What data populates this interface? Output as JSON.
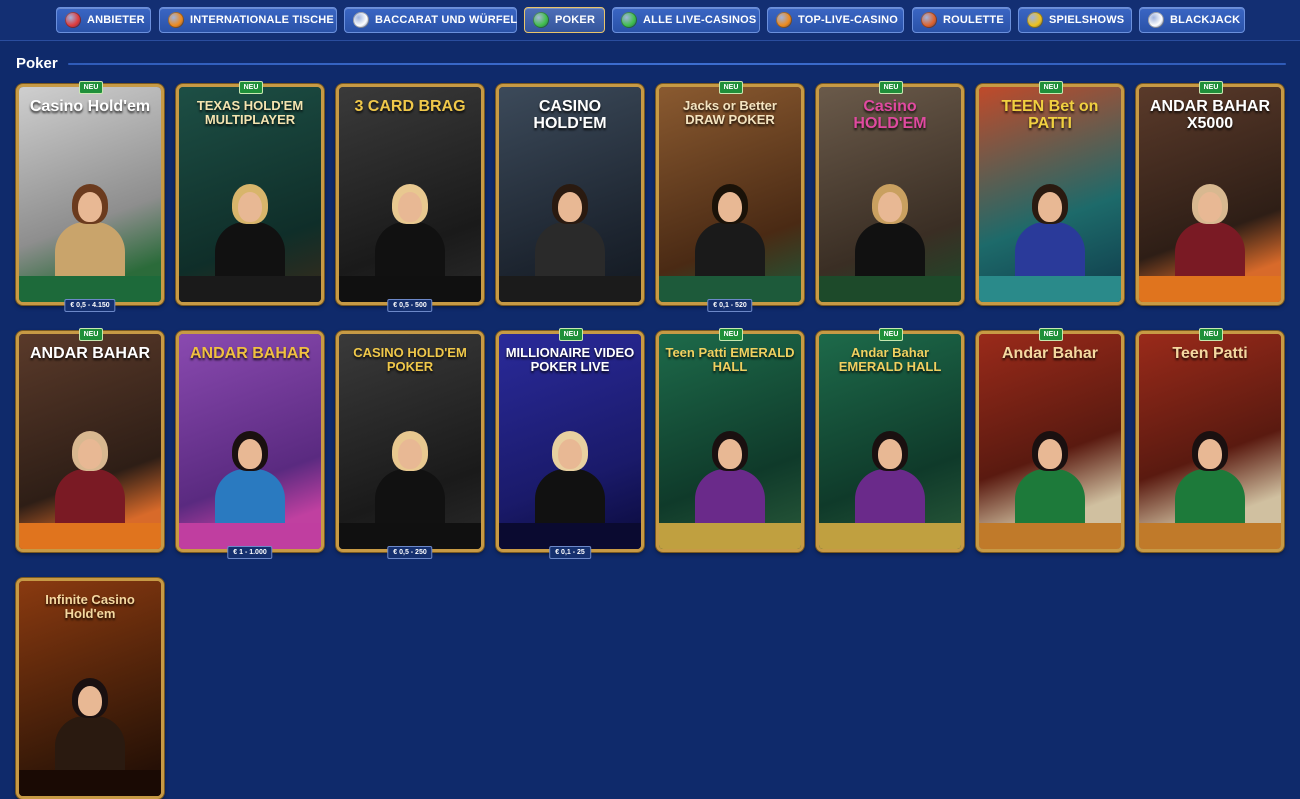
{
  "categories": [
    {
      "label": "ANBIETER",
      "icon": "provider-icon",
      "color": "#e03a3a",
      "active": false
    },
    {
      "label": "INTERNATIONALE TISCHE",
      "icon": "compass-icon",
      "color": "#f08a1a",
      "active": false
    },
    {
      "label": "BACCARAT UND WÜRFEL",
      "icon": "dice-cards-icon",
      "color": "#ffffff",
      "active": false
    },
    {
      "label": "POKER",
      "icon": "poker-chips-icon",
      "color": "#3fbf4a",
      "active": true
    },
    {
      "label": "ALLE LIVE-CASINOS",
      "icon": "chips-icon",
      "color": "#3fbf4a",
      "active": false
    },
    {
      "label": "TOP-LIVE-CASINO",
      "icon": "star-icon",
      "color": "#f08a1a",
      "active": false
    },
    {
      "label": "ROULETTE",
      "icon": "roulette-icon",
      "color": "#e0622a",
      "active": false
    },
    {
      "label": "SPIELSHOWS",
      "icon": "microphone-icon",
      "color": "#f0c21a",
      "active": false
    },
    {
      "label": "BLACKJACK",
      "icon": "cards-icon",
      "color": "#ffffff",
      "active": false
    }
  ],
  "section": {
    "title": "Poker"
  },
  "games": [
    {
      "name": "Casino Hold'em",
      "badge": "NEU",
      "limit": "€ 0,5 - 4.150",
      "theme": "marble"
    },
    {
      "name": "TEXAS HOLD'EM MULTIPLAYER",
      "badge": "NEU",
      "limit": "",
      "theme": "green"
    },
    {
      "name": "3 CARD BRAG",
      "badge": "",
      "limit": "€ 0,5 - 500",
      "theme": "dark"
    },
    {
      "name": "CASINO HOLD'EM",
      "badge": "",
      "limit": "",
      "theme": "steel"
    },
    {
      "name": "Jacks or Better DRAW POKER",
      "badge": "NEU",
      "limit": "€ 0,1 - 520",
      "theme": "wood"
    },
    {
      "name": "Casino HOLD'EM",
      "badge": "NEU",
      "limit": "",
      "theme": "loft"
    },
    {
      "name": "TEEN Bet on PATTI",
      "badge": "NEU",
      "limit": "",
      "theme": "teal"
    },
    {
      "name": "ANDAR BAHAR X5000",
      "badge": "NEU",
      "limit": "",
      "theme": "brown"
    },
    {
      "name": "ANDAR BAHAR",
      "badge": "NEU",
      "limit": "",
      "theme": "brown"
    },
    {
      "name": "ANDAR BAHAR",
      "badge": "",
      "limit": "€ 1 - 1.000",
      "theme": "purple"
    },
    {
      "name": "CASINO HOLD'EM POKER",
      "badge": "",
      "limit": "€ 0,5 - 250",
      "theme": "dark"
    },
    {
      "name": "MILLIONAIRE VIDEO POKER LIVE",
      "badge": "NEU",
      "limit": "€ 0,1 - 25",
      "theme": "blue"
    },
    {
      "name": "Teen Patti EMERALD HALL",
      "badge": "NEU",
      "limit": "",
      "theme": "emerald"
    },
    {
      "name": "Andar Bahar EMERALD HALL",
      "badge": "NEU",
      "limit": "",
      "theme": "emerald"
    },
    {
      "name": "Andar Bahar",
      "badge": "NEU",
      "limit": "",
      "theme": "red"
    },
    {
      "name": "Teen Patti",
      "badge": "NEU",
      "limit": "",
      "theme": "red"
    },
    {
      "name": "Infinite Casino Hold'em",
      "badge": "",
      "limit": "",
      "theme": "orange"
    }
  ]
}
